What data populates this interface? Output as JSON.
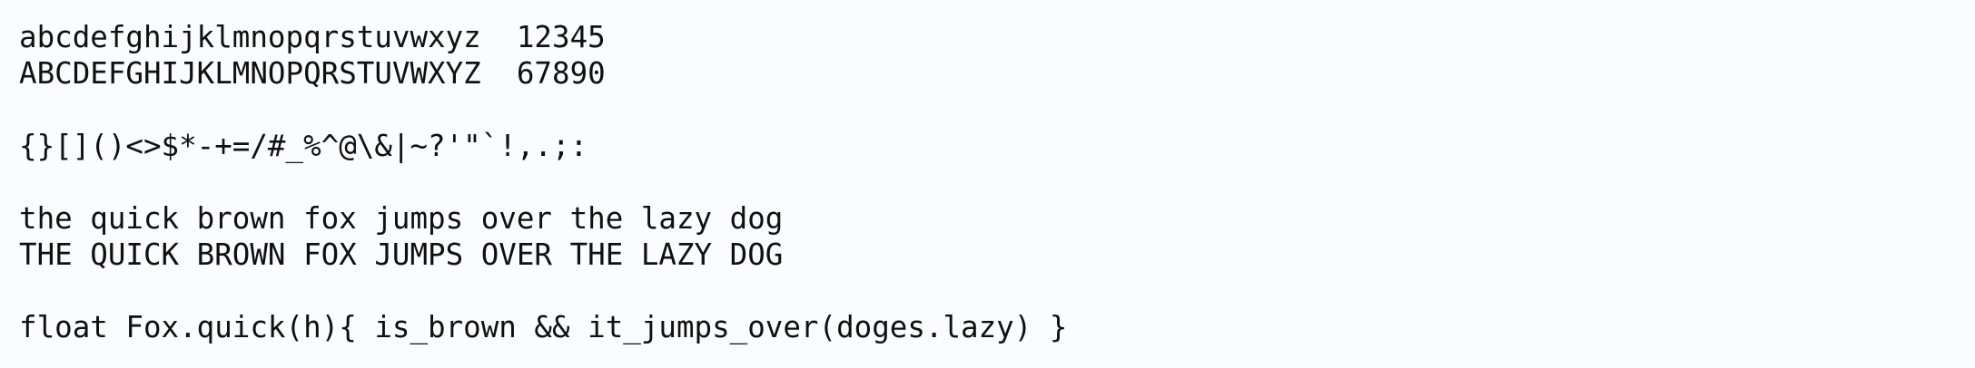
{
  "specimen": {
    "lines": [
      "abcdefghijklmnopqrstuvwxyz  12345",
      "ABCDEFGHIJKLMNOPQRSTUVWXYZ  67890",
      "{}[]()<>$*-+=/#_%^@\\&|~?'\"`!,.;:",
      "the quick brown fox jumps over the lazy dog",
      "THE QUICK BROWN FOX JUMPS OVER THE LAZY DOG",
      "float Fox.quick(h){ is_brown && it_jumps_over(doges.lazy) }"
    ]
  }
}
